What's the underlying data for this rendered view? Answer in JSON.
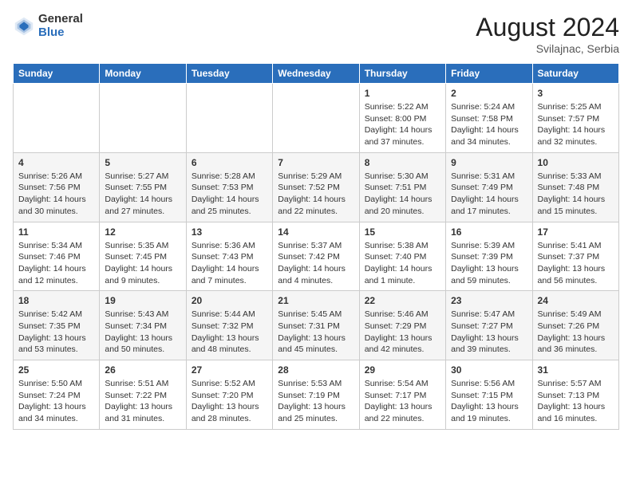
{
  "header": {
    "logo_general": "General",
    "logo_blue": "Blue",
    "month_year": "August 2024",
    "location": "Svilajnac, Serbia"
  },
  "weekdays": [
    "Sunday",
    "Monday",
    "Tuesday",
    "Wednesday",
    "Thursday",
    "Friday",
    "Saturday"
  ],
  "rows": [
    [
      {
        "day": "",
        "info": ""
      },
      {
        "day": "",
        "info": ""
      },
      {
        "day": "",
        "info": ""
      },
      {
        "day": "",
        "info": ""
      },
      {
        "day": "1",
        "info": "Sunrise: 5:22 AM\nSunset: 8:00 PM\nDaylight: 14 hours\nand 37 minutes."
      },
      {
        "day": "2",
        "info": "Sunrise: 5:24 AM\nSunset: 7:58 PM\nDaylight: 14 hours\nand 34 minutes."
      },
      {
        "day": "3",
        "info": "Sunrise: 5:25 AM\nSunset: 7:57 PM\nDaylight: 14 hours\nand 32 minutes."
      }
    ],
    [
      {
        "day": "4",
        "info": "Sunrise: 5:26 AM\nSunset: 7:56 PM\nDaylight: 14 hours\nand 30 minutes."
      },
      {
        "day": "5",
        "info": "Sunrise: 5:27 AM\nSunset: 7:55 PM\nDaylight: 14 hours\nand 27 minutes."
      },
      {
        "day": "6",
        "info": "Sunrise: 5:28 AM\nSunset: 7:53 PM\nDaylight: 14 hours\nand 25 minutes."
      },
      {
        "day": "7",
        "info": "Sunrise: 5:29 AM\nSunset: 7:52 PM\nDaylight: 14 hours\nand 22 minutes."
      },
      {
        "day": "8",
        "info": "Sunrise: 5:30 AM\nSunset: 7:51 PM\nDaylight: 14 hours\nand 20 minutes."
      },
      {
        "day": "9",
        "info": "Sunrise: 5:31 AM\nSunset: 7:49 PM\nDaylight: 14 hours\nand 17 minutes."
      },
      {
        "day": "10",
        "info": "Sunrise: 5:33 AM\nSunset: 7:48 PM\nDaylight: 14 hours\nand 15 minutes."
      }
    ],
    [
      {
        "day": "11",
        "info": "Sunrise: 5:34 AM\nSunset: 7:46 PM\nDaylight: 14 hours\nand 12 minutes."
      },
      {
        "day": "12",
        "info": "Sunrise: 5:35 AM\nSunset: 7:45 PM\nDaylight: 14 hours\nand 9 minutes."
      },
      {
        "day": "13",
        "info": "Sunrise: 5:36 AM\nSunset: 7:43 PM\nDaylight: 14 hours\nand 7 minutes."
      },
      {
        "day": "14",
        "info": "Sunrise: 5:37 AM\nSunset: 7:42 PM\nDaylight: 14 hours\nand 4 minutes."
      },
      {
        "day": "15",
        "info": "Sunrise: 5:38 AM\nSunset: 7:40 PM\nDaylight: 14 hours\nand 1 minute."
      },
      {
        "day": "16",
        "info": "Sunrise: 5:39 AM\nSunset: 7:39 PM\nDaylight: 13 hours\nand 59 minutes."
      },
      {
        "day": "17",
        "info": "Sunrise: 5:41 AM\nSunset: 7:37 PM\nDaylight: 13 hours\nand 56 minutes."
      }
    ],
    [
      {
        "day": "18",
        "info": "Sunrise: 5:42 AM\nSunset: 7:35 PM\nDaylight: 13 hours\nand 53 minutes."
      },
      {
        "day": "19",
        "info": "Sunrise: 5:43 AM\nSunset: 7:34 PM\nDaylight: 13 hours\nand 50 minutes."
      },
      {
        "day": "20",
        "info": "Sunrise: 5:44 AM\nSunset: 7:32 PM\nDaylight: 13 hours\nand 48 minutes."
      },
      {
        "day": "21",
        "info": "Sunrise: 5:45 AM\nSunset: 7:31 PM\nDaylight: 13 hours\nand 45 minutes."
      },
      {
        "day": "22",
        "info": "Sunrise: 5:46 AM\nSunset: 7:29 PM\nDaylight: 13 hours\nand 42 minutes."
      },
      {
        "day": "23",
        "info": "Sunrise: 5:47 AM\nSunset: 7:27 PM\nDaylight: 13 hours\nand 39 minutes."
      },
      {
        "day": "24",
        "info": "Sunrise: 5:49 AM\nSunset: 7:26 PM\nDaylight: 13 hours\nand 36 minutes."
      }
    ],
    [
      {
        "day": "25",
        "info": "Sunrise: 5:50 AM\nSunset: 7:24 PM\nDaylight: 13 hours\nand 34 minutes."
      },
      {
        "day": "26",
        "info": "Sunrise: 5:51 AM\nSunset: 7:22 PM\nDaylight: 13 hours\nand 31 minutes."
      },
      {
        "day": "27",
        "info": "Sunrise: 5:52 AM\nSunset: 7:20 PM\nDaylight: 13 hours\nand 28 minutes."
      },
      {
        "day": "28",
        "info": "Sunrise: 5:53 AM\nSunset: 7:19 PM\nDaylight: 13 hours\nand 25 minutes."
      },
      {
        "day": "29",
        "info": "Sunrise: 5:54 AM\nSunset: 7:17 PM\nDaylight: 13 hours\nand 22 minutes."
      },
      {
        "day": "30",
        "info": "Sunrise: 5:56 AM\nSunset: 7:15 PM\nDaylight: 13 hours\nand 19 minutes."
      },
      {
        "day": "31",
        "info": "Sunrise: 5:57 AM\nSunset: 7:13 PM\nDaylight: 13 hours\nand 16 minutes."
      }
    ]
  ]
}
